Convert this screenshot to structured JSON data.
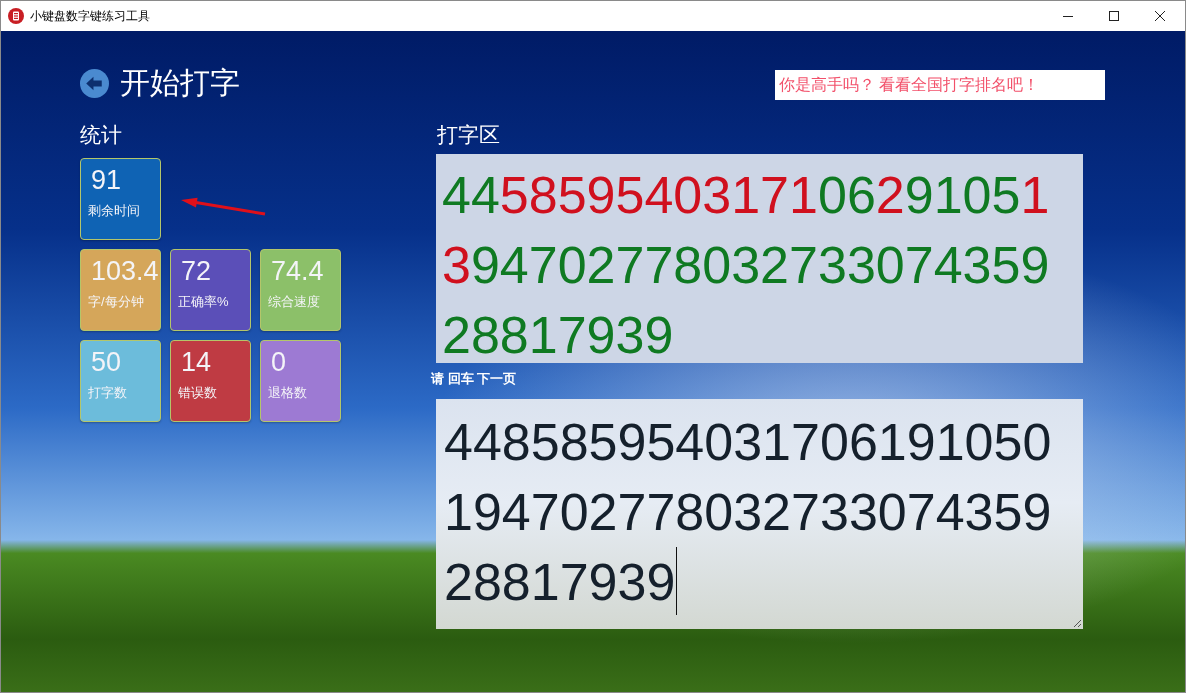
{
  "window": {
    "title": "小键盘数字键练习工具"
  },
  "header": {
    "title": "开始打字",
    "ranking_link": "你是高手吗？ 看看全国打字排名吧！"
  },
  "stats": {
    "heading": "统计",
    "tiles": [
      {
        "value": "91",
        "label": "剩余时间",
        "color": "#0f63b4"
      },
      {
        "value": "103.4",
        "label": "字/每分钟",
        "color": "#d5a65a"
      },
      {
        "value": "72",
        "label": "正确率%",
        "color": "#5b4fb8"
      },
      {
        "value": "74.4",
        "label": "综合速度",
        "color": "#8cc069"
      },
      {
        "value": "50",
        "label": "打字数",
        "color": "#6cbcdb"
      },
      {
        "value": "14",
        "label": "错误数",
        "color": "#bf3b43"
      },
      {
        "value": "0",
        "label": "退格数",
        "color": "#9d7ad3"
      }
    ]
  },
  "typing_area": {
    "heading": "打字区",
    "reference_lines": [
      {
        "segments": [
          {
            "text": "44",
            "correct": true
          },
          {
            "text": "58595403171",
            "correct": false
          },
          {
            "text": "06",
            "correct": true
          },
          {
            "text": "2",
            "correct": false
          },
          {
            "text": "9105",
            "correct": true
          },
          {
            "text": "1",
            "correct": false
          }
        ]
      },
      {
        "segments": [
          {
            "text": "3",
            "correct": false
          },
          {
            "text": "94702778032733074359",
            "correct": true
          }
        ]
      },
      {
        "segments": [
          {
            "text": "28817939",
            "correct": true
          }
        ]
      }
    ],
    "hint": "请 回车 下一页",
    "input": {
      "lines": [
        "448585954031706191050",
        "194702778032733074359",
        "28817939"
      ],
      "focused": true
    }
  }
}
